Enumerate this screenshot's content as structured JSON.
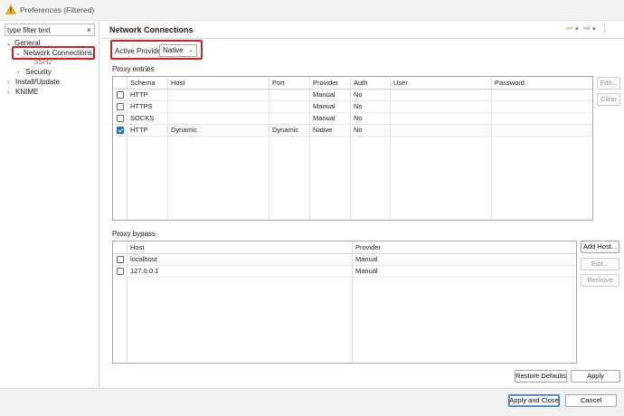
{
  "window": {
    "title": "Preferences (Filtered)"
  },
  "sidebar": {
    "filter_placeholder": "type filter text",
    "filter_value": "type filter text",
    "clear_icon": "×",
    "items": [
      {
        "label": "General",
        "chevron": "⌄"
      },
      {
        "label": "Network Connections",
        "chevron": "⌄"
      },
      {
        "label": "SSH2",
        "chevron": ""
      },
      {
        "label": "Security",
        "chevron": "›"
      },
      {
        "label": "Install/Update",
        "chevron": "›"
      },
      {
        "label": "KNIME",
        "chevron": "›"
      }
    ]
  },
  "header": {
    "title": "Network Connections",
    "back_icon": "⇦",
    "forward_icon": "⇨",
    "dropdown_icon": "▾",
    "menu_icon": "⋮"
  },
  "active_provider": {
    "label": "Active Provider:",
    "value": "Native",
    "arrow": "⌄"
  },
  "proxy_entries": {
    "label": "Proxy entries",
    "columns": [
      "Schema",
      "Host",
      "Port",
      "Provider",
      "Auth",
      "User",
      "Password"
    ],
    "rows": [
      {
        "checked": false,
        "schema": "HTTP",
        "host": "",
        "port": "",
        "provider": "Manual",
        "auth": "No",
        "user": "",
        "password": ""
      },
      {
        "checked": false,
        "schema": "HTTPS",
        "host": "",
        "port": "",
        "provider": "Manual",
        "auth": "No",
        "user": "",
        "password": ""
      },
      {
        "checked": false,
        "schema": "SOCKS",
        "host": "",
        "port": "",
        "provider": "Manual",
        "auth": "No",
        "user": "",
        "password": ""
      },
      {
        "checked": true,
        "schema": "HTTP",
        "host": "Dynamic",
        "port": "Dynamic",
        "provider": "Native",
        "auth": "No",
        "user": "",
        "password": ""
      }
    ],
    "edit_label": "Edit...",
    "clear_label": "Clear"
  },
  "proxy_bypass": {
    "label": "Proxy bypass",
    "columns": [
      "Host",
      "Provider"
    ],
    "rows": [
      {
        "checked": false,
        "host": "localhost",
        "provider": "Manual"
      },
      {
        "checked": false,
        "host": "127.0.0.1",
        "provider": "Manual"
      }
    ],
    "add_host_label": "Add Host...",
    "edit_label": "Edit...",
    "remove_label": "Remove"
  },
  "footer": {
    "restore_defaults_label": "Restore Defaults",
    "apply_label": "Apply",
    "apply_close_label": "Apply and Close",
    "cancel_label": "Cancel"
  },
  "colors": {
    "highlight": "#d32027",
    "accent": "#1f6fd0",
    "warning": "#f0b400"
  }
}
